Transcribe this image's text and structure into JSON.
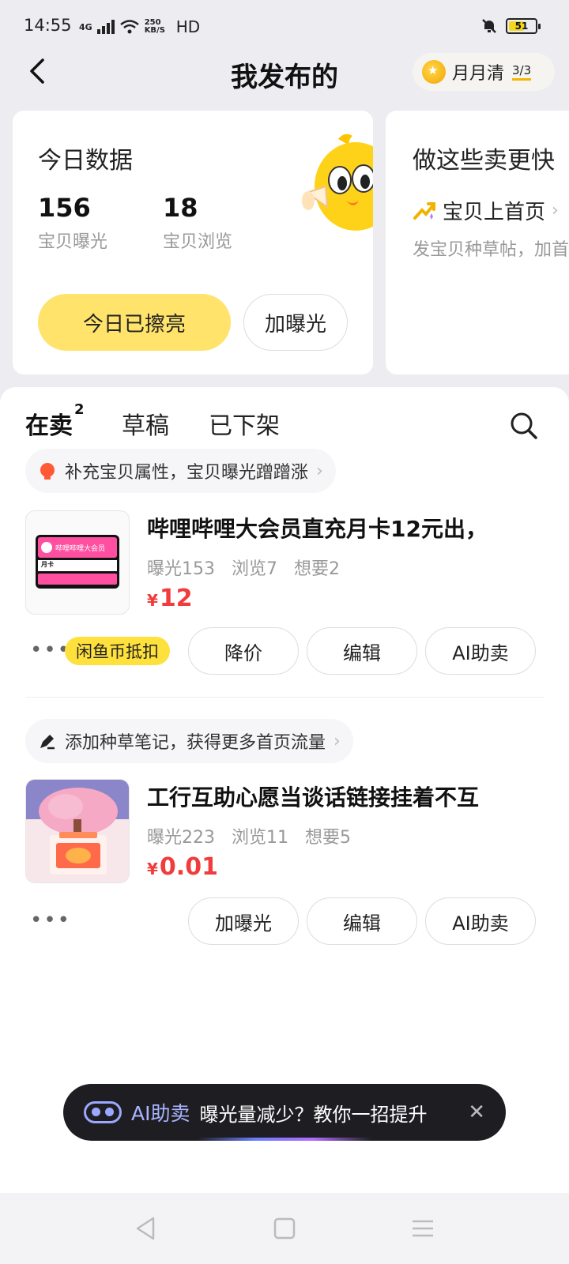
{
  "status_bar": {
    "time": "14:55",
    "network": "4G",
    "speed": "250 KB/S",
    "hd": "HD",
    "battery": "51"
  },
  "header": {
    "title": "我发布的",
    "monthly_label": "月月清",
    "monthly_count": "3/3"
  },
  "today_data": {
    "title": "今日数据",
    "stats": [
      {
        "value": "156",
        "label": "宝贝曝光"
      },
      {
        "value": "18",
        "label": "宝贝浏览"
      }
    ],
    "primary_button": "今日已擦亮",
    "secondary_button": "加曝光"
  },
  "tips_card": {
    "title": "做这些卖更快",
    "item": "宝贝上首页",
    "desc": "发宝贝种草帖，加首"
  },
  "tabs": [
    {
      "label": "在卖",
      "badge": "2"
    },
    {
      "label": "草稿"
    },
    {
      "label": "已下架"
    }
  ],
  "items": [
    {
      "hint": "补充宝贝属性，宝贝曝光蹭蹭涨",
      "title": "哔哩哔哩大会员直充月卡12元出，",
      "stats": "曝光153   浏览7   想要2",
      "price_symbol": "¥",
      "price": "12",
      "badge": "闲鱼币抵扣",
      "actions": [
        "降价",
        "编辑",
        "AI助卖"
      ],
      "thumb_text": "哔哩哔哩大会员",
      "thumb_card": "月卡"
    },
    {
      "hint": "添加种草笔记，获得更多首页流量",
      "title": "工行互助心愿当谈话链接挂着不互",
      "stats": "曝光223   浏览11   想要5",
      "price_symbol": "¥",
      "price": "0.01",
      "actions": [
        "加曝光",
        "编辑",
        "AI助卖"
      ]
    }
  ],
  "ai_toast": {
    "label": "AI助卖",
    "message": "曝光量减少？教你一招提升",
    "close": "✕"
  },
  "colors": {
    "accent_yellow": "#ffe36b",
    "price_red": "#f03c3c",
    "toast_bg": "#1e1e22"
  }
}
